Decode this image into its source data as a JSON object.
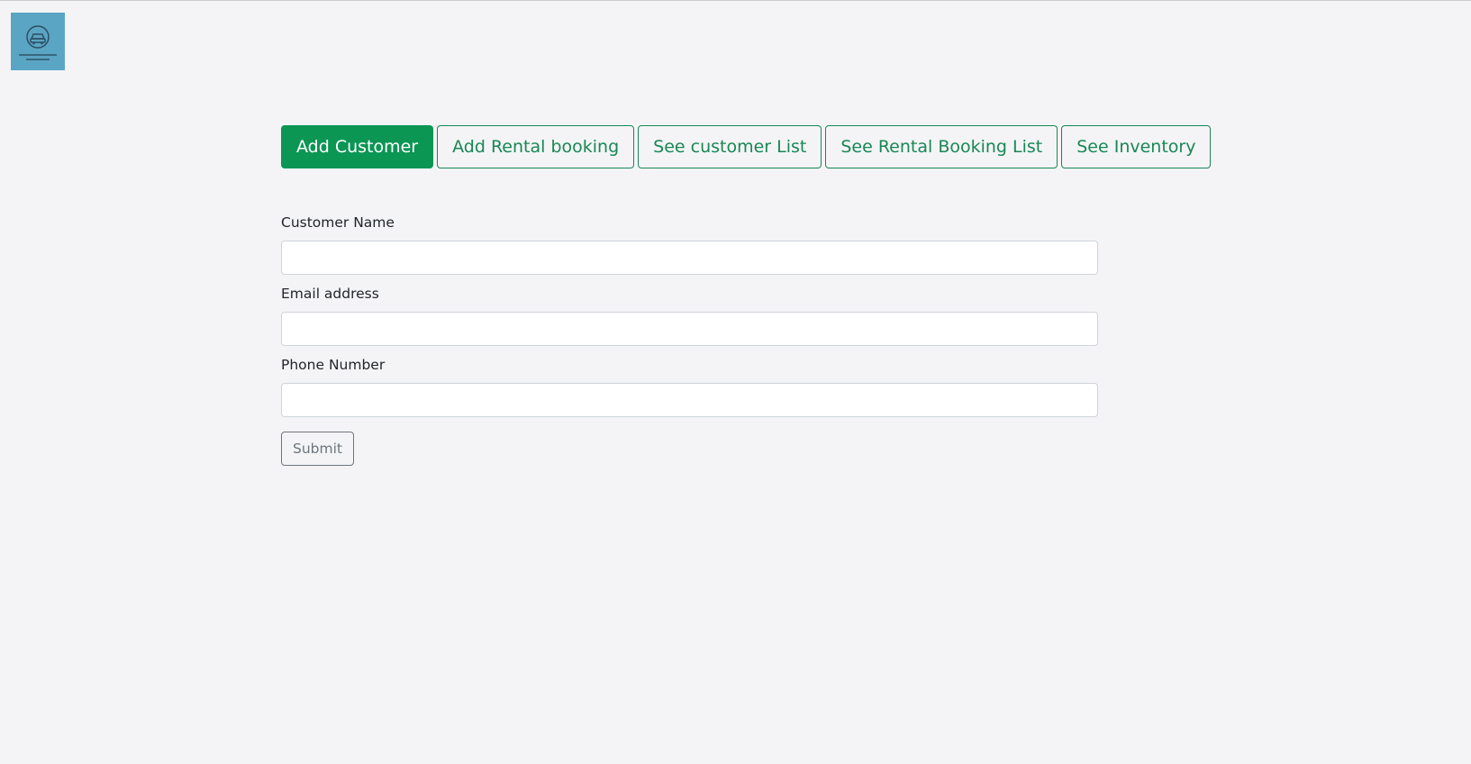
{
  "logo": {
    "icon": "car-logo-icon",
    "color": "#5ba5c4"
  },
  "nav": {
    "items": [
      {
        "label": "Add Customer",
        "active": true
      },
      {
        "label": "Add Rental booking",
        "active": false
      },
      {
        "label": "See customer List",
        "active": false
      },
      {
        "label": "See Rental Booking List",
        "active": false
      },
      {
        "label": "See Inventory",
        "active": false
      }
    ],
    "accent_color": "#198754"
  },
  "form": {
    "customer_name": {
      "label": "Customer Name",
      "value": ""
    },
    "email": {
      "label": "Email address",
      "value": ""
    },
    "phone": {
      "label": "Phone Number",
      "value": ""
    },
    "submit_label": "Submit"
  }
}
